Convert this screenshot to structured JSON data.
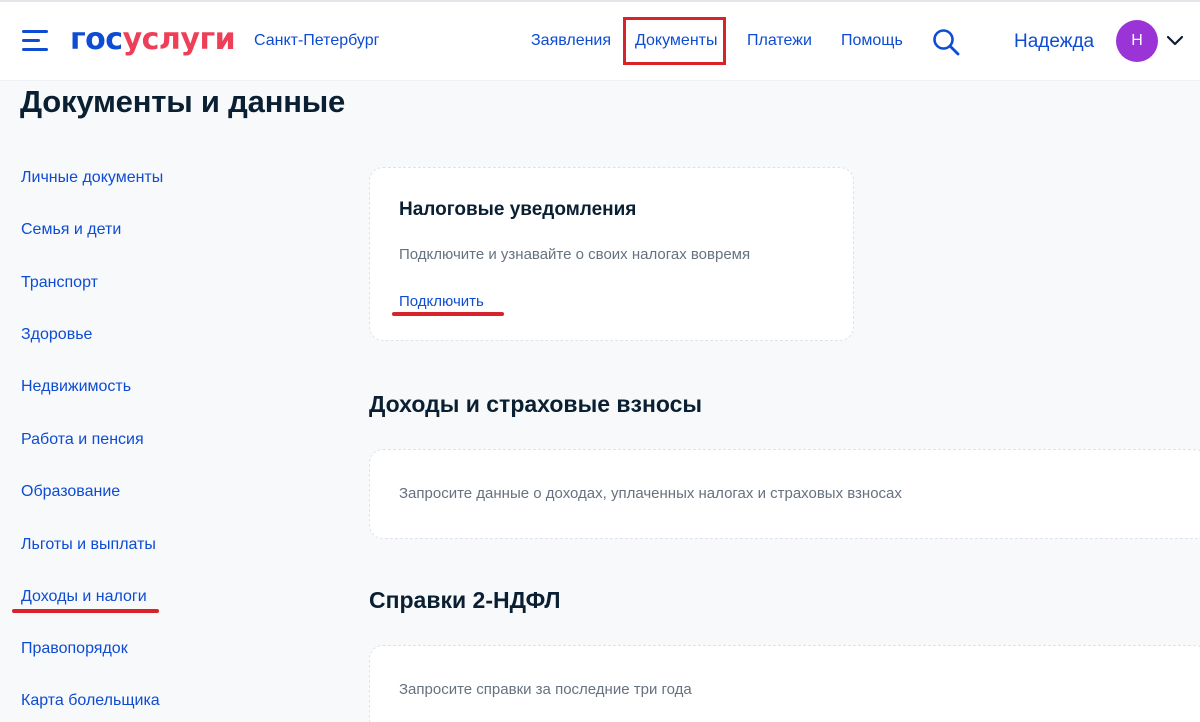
{
  "header": {
    "logo_part1": "гос",
    "logo_part2": "услуги",
    "city": "Санкт-Петербург",
    "nav": [
      "Заявления",
      "Документы",
      "Платежи",
      "Помощь"
    ],
    "user_name": "Надежда",
    "avatar_letter": "Н",
    "icons": {
      "menu": "burger-menu-icon",
      "search": "search-icon",
      "dropdown": "chevron-down-icon"
    }
  },
  "page": {
    "title": "Документы и данные"
  },
  "sidebar": {
    "items": [
      "Личные документы",
      "Семья и дети",
      "Транспорт",
      "Здоровье",
      "Недвижимость",
      "Работа и пенсия",
      "Образование",
      "Льготы и выплаты",
      "Доходы и налоги",
      "Правопорядок",
      "Карта болельщика"
    ]
  },
  "tax_card": {
    "title": "Налоговые уведомления",
    "text": "Подключите и узнавайте о своих налогах вовремя",
    "link": "Подключить"
  },
  "income_section": {
    "title": "Доходы и страховые взносы",
    "text": "Запросите данные о доходах, уплаченных налогах и страховых взносах"
  },
  "ndfl_section": {
    "title": "Справки 2-НДФЛ",
    "text": "Запросите справки за последние три года"
  },
  "colors": {
    "brand_blue": "#0d4cd3",
    "brand_red": "#ee3f58",
    "annotation_red": "#d8232a",
    "avatar": "#9b34d6"
  }
}
